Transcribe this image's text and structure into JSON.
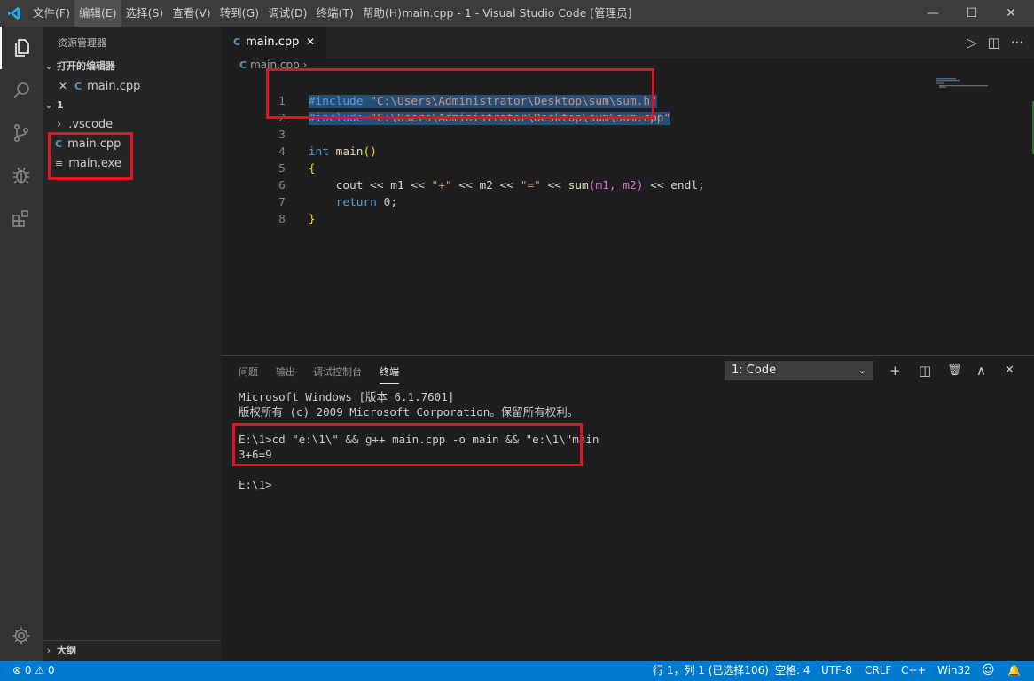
{
  "window": {
    "title": "main.cpp - 1 - Visual Studio Code [管理员]",
    "menu": [
      "文件(F)",
      "编辑(E)",
      "选择(S)",
      "查看(V)",
      "转到(G)",
      "调试(D)",
      "终端(T)",
      "帮助(H)"
    ],
    "active_menu": "编辑(E)",
    "controls": {
      "minimize": "—",
      "maximize": "☐",
      "close": "✕"
    }
  },
  "activity_bar": {
    "icons": [
      "files-icon",
      "search-icon",
      "source-control-icon",
      "debug-icon",
      "extensions-icon",
      "settings-gear-icon"
    ]
  },
  "sidebar": {
    "title": "资源管理器",
    "open_editors": {
      "header": "打开的编辑器",
      "items": [
        {
          "close": "✕",
          "icon": "C",
          "name": "main.cpp"
        }
      ]
    },
    "folder": {
      "header": "1",
      "items": [
        {
          "chevron": "›",
          "name": ".vscode"
        },
        {
          "icon": "C",
          "name": "main.cpp"
        },
        {
          "icon": "≡",
          "name": "main.exe"
        }
      ]
    },
    "outline": {
      "header": "大纲"
    }
  },
  "editor": {
    "tab": {
      "icon": "C",
      "label": "main.cpp",
      "close": "✕"
    },
    "actions": {
      "run": "▷",
      "split": "◫",
      "more": "···"
    },
    "breadcrumb": "main.cpp ›",
    "lines": [
      {
        "n": "1",
        "pre": "#include",
        "str": "\"C:\\Users\\Administrator\\Desktop\\sum\\sum.h\""
      },
      {
        "n": "2",
        "pre": "#include",
        "str": "\"C:\\Users\\Administrator\\Desktop\\sum\\sum.cpp\""
      },
      {
        "n": "3"
      },
      {
        "n": "4",
        "kw": "int",
        "fn": "main",
        "paren": "()"
      },
      {
        "n": "5",
        "brace": "{"
      },
      {
        "n": "6",
        "a": "    cout << m1 << ",
        "s1": "\"+\"",
        "b": " << m2 << ",
        "s2": "\"=\"",
        "c": " << ",
        "fn": "sum",
        "args": "(m1, m2)",
        "d": " << endl;"
      },
      {
        "n": "7",
        "ret": "return",
        "num": "0",
        "semi": ";"
      },
      {
        "n": "8",
        "brace": "}"
      }
    ]
  },
  "panel": {
    "tabs": [
      "问题",
      "输出",
      "调试控制台",
      "终端"
    ],
    "active_tab": "终端",
    "terminal_select": "1: Code",
    "controls": {
      "add": "+",
      "split": "◫",
      "trash": "🗑",
      "maximize": "∧",
      "close": "✕"
    },
    "terminal_lines": [
      "Microsoft Windows [版本 6.1.7601]",
      "版权所有 (c) 2009 Microsoft Corporation。保留所有权利。",
      "",
      "E:\\1>cd \"e:\\1\\\" && g++ main.cpp -o main && \"e:\\1\\\"main",
      "3+6=9",
      "",
      "E:\\1>"
    ]
  },
  "status_bar": {
    "errors": "0",
    "warnings": "0",
    "position": "行 1，列 1 (已选择106)",
    "spaces": "空格: 4",
    "encoding": "UTF-8",
    "eol": "CRLF",
    "language": "C++",
    "platform": "Win32",
    "feedback_icon": "☺",
    "bell_icon": "🔔"
  },
  "colors": {
    "accent": "#007acc",
    "highlight_box": "#e81123",
    "selection": "#264f78"
  }
}
